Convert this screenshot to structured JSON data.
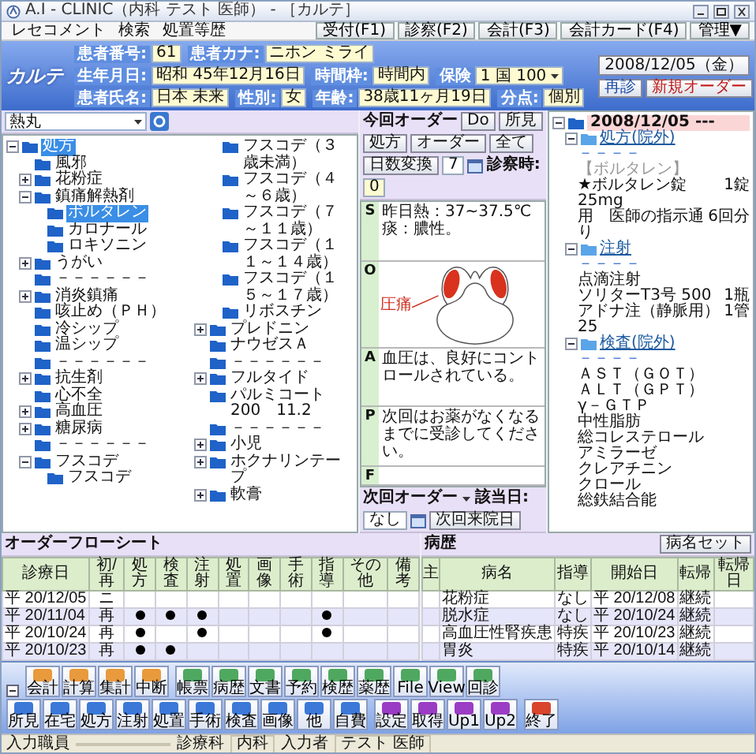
{
  "window": {
    "title": "A.I - CLINIC（内科 テスト 医師） - ［カルテ］"
  },
  "menu": [
    "レセコメント",
    "検索",
    "処置等歴"
  ],
  "top_buttons": [
    "受付(F1)",
    "診察(F2)",
    "会計(F3)",
    "会計カード(F4)",
    "管理▼"
  ],
  "patient": {
    "logo": "カルテ",
    "insurance_label": "保険",
    "insurance": "1 国 100",
    "fields": [
      {
        "label": "患者番号:",
        "value": "61"
      },
      {
        "label": "患者カナ:",
        "value": "ニホン ミライ"
      },
      {
        "label": "生年月日:",
        "value": "昭和 45年12月16日"
      },
      {
        "label": "時間枠:",
        "value": "時間内"
      },
      {
        "label": "患者氏名:",
        "value": "日本 未来"
      },
      {
        "label": "性別:",
        "value": "女"
      },
      {
        "label": "年齢:",
        "value": "38歳11ヶ月19日"
      },
      {
        "label": "分点:",
        "value": "個別"
      }
    ],
    "date": "2008/12/05（金）",
    "visit_type": "再診",
    "new_order": "新規オーダー"
  },
  "set_panel": {
    "category": "熱丸",
    "tree": [
      {
        "label": "処方",
        "expanded": true,
        "selected": true,
        "children": [
          {
            "label": "風邪",
            "selected": false
          },
          {
            "label": "花粉症",
            "expanded": false,
            "selected": false
          },
          {
            "label": "鎮痛解熱剤",
            "expanded": true,
            "selected": false,
            "children": [
              {
                "label": "ボルタレン",
                "selected": true
              },
              {
                "label": "カロナール",
                "selected": false
              },
              {
                "label": "ロキソニン",
                "selected": false
              }
            ]
          },
          {
            "label": "うがい",
            "expanded": false,
            "selected": false
          },
          {
            "label": "－－－－－－",
            "selected": false
          },
          {
            "label": "消炎鎮痛",
            "expanded": false,
            "selected": false
          },
          {
            "label": "咳止め（ＰＨ）",
            "selected": false
          },
          {
            "label": "冷シップ",
            "selected": false
          },
          {
            "label": "温シップ",
            "selected": false
          },
          {
            "label": "－－－－－－",
            "selected": false
          },
          {
            "label": "抗生剤",
            "expanded": false,
            "selected": false
          },
          {
            "label": "心不全",
            "selected": false
          },
          {
            "label": "高血圧",
            "expanded": false,
            "selected": false
          },
          {
            "label": "糖尿病",
            "expanded": false,
            "selected": false
          },
          {
            "label": "－－－－－－",
            "selected": false
          },
          {
            "label": "フスコデ",
            "expanded": true,
            "selected": false,
            "children": [
              {
                "label": "フスコデ",
                "selected": false
              },
              {
                "label": "フスコデ（３歳未満）",
                "selected": false
              },
              {
                "label": "フスコデ（４～６歳）",
                "selected": false
              },
              {
                "label": "フスコデ（７～１１歳）",
                "selected": false
              },
              {
                "label": "フスコデ（１１～１４歳）",
                "selected": false
              },
              {
                "label": "フスコデ（１５～１７歳）",
                "selected": false
              },
              {
                "label": "リボスチン",
                "selected": false
              }
            ]
          },
          {
            "label": "プレドニン",
            "expanded": false,
            "selected": false
          },
          {
            "label": "ナウゼスＡ",
            "selected": false
          },
          {
            "label": "－－－－－－",
            "selected": false
          },
          {
            "label": "フルタイド",
            "expanded": false,
            "selected": false
          },
          {
            "label": "パルミコート200　11.2",
            "selected": false
          },
          {
            "label": "－－－－－－",
            "selected": false
          },
          {
            "label": "小児",
            "expanded": false,
            "selected": false
          },
          {
            "label": "ホクナリンテープ",
            "expanded": false,
            "selected": false
          },
          {
            "label": "軟膏",
            "expanded": false,
            "selected": false
          }
        ]
      }
    ]
  },
  "order_bar": {
    "title": "今回オーダー",
    "buttons": [
      "Do",
      "所見",
      "処方",
      "オーダー",
      "全て"
    ],
    "convert": "日数変換",
    "days": "7",
    "exam_time_label": "診察時:",
    "exam_time": "0"
  },
  "soap": [
    {
      "letter": "S",
      "kind": "text",
      "lines": [
        "昨日熱：37~37.5℃",
        "痰：膿性。"
      ]
    },
    {
      "letter": "O",
      "kind": "drawing",
      "label": "圧痛"
    },
    {
      "letter": "A",
      "kind": "text",
      "lines": [
        "血圧は、良好にコントロールされている。"
      ]
    },
    {
      "letter": "P",
      "kind": "text",
      "lines": [
        "次回はお薬がなくなるまでに受診してください。"
      ]
    },
    {
      "letter": "F",
      "kind": "text"
    }
  ],
  "order_tree": [
    {
      "kind": "date",
      "label": "2008/12/05 ---",
      "expanded": true,
      "children": [
        {
          "kind": "group",
          "label": "処方(院外)",
          "expanded": true,
          "children": [
            {
              "kind": "dash",
              "label": "－－－－"
            },
            {
              "kind": "note",
              "label": "【ボルタレン】"
            },
            {
              "kind": "item",
              "label": "★ボルタレン錠 25mg",
              "qty": "1錠"
            },
            {
              "kind": "item",
              "label": "用　医師の指示通り",
              "qty": "6回分"
            }
          ]
        },
        {
          "kind": "group",
          "label": "注射",
          "expanded": true,
          "children": [
            {
              "kind": "dash",
              "label": "－－－－"
            },
            {
              "kind": "item",
              "label": "点滴注射"
            },
            {
              "kind": "item",
              "label": "ソリターT3号 500",
              "qty": "1瓶"
            },
            {
              "kind": "item",
              "label": "アドナ注（静脈用）25",
              "qty": "1管"
            }
          ]
        },
        {
          "kind": "group",
          "label": "検査(院外)",
          "expanded": true,
          "children": [
            {
              "kind": "dash",
              "label": "－－－－"
            },
            {
              "kind": "item",
              "label": "ＡＳＴ（ＧＯＴ）"
            },
            {
              "kind": "item",
              "label": "ＡＬＴ（ＧＰＴ）"
            },
            {
              "kind": "item",
              "label": "γ－ＧＴＰ"
            },
            {
              "kind": "item",
              "label": "中性脂肪"
            },
            {
              "kind": "item",
              "label": "総コレステロール"
            },
            {
              "kind": "item",
              "label": "アミラーゼ"
            },
            {
              "kind": "item",
              "label": "クレアチニン"
            },
            {
              "kind": "item",
              "label": "クロール"
            },
            {
              "kind": "item",
              "label": "総鉄結合能"
            }
          ]
        }
      ]
    }
  ],
  "next_order": {
    "label": "次回オーダー",
    "date_label": "該当日:",
    "date": "なし",
    "button": "次回来院日"
  },
  "flow_sheet": {
    "title": "オーダーフローシート",
    "columns": [
      "診療日",
      "初/再",
      "処方",
      "検査",
      "注射",
      "処置",
      "画像",
      "手術",
      "指導",
      "その他",
      "備考"
    ],
    "rows": [
      {
        "date": "平 20/12/05",
        "visit": "ニ",
        "marks": [
          false,
          false,
          false,
          false,
          false,
          false,
          false,
          false,
          false
        ]
      },
      {
        "date": "平 20/11/04",
        "visit": "再",
        "marks": [
          true,
          true,
          true,
          false,
          false,
          false,
          true,
          false,
          false
        ]
      },
      {
        "date": "平 20/10/24",
        "visit": "再",
        "marks": [
          true,
          false,
          true,
          false,
          false,
          false,
          true,
          false,
          false
        ]
      },
      {
        "date": "平 20/10/23",
        "visit": "再",
        "marks": [
          true,
          true,
          false,
          false,
          false,
          false,
          false,
          false,
          false
        ]
      }
    ]
  },
  "history": {
    "title": "病歴",
    "button": "病名セット",
    "columns": [
      "主",
      "病名",
      "指導",
      "開始日",
      "転帰",
      "転帰日"
    ],
    "rows": [
      {
        "name": "花粉症",
        "guidance": "なし",
        "start": "平 20/12/08",
        "outcome": "継続"
      },
      {
        "name": "脱水症",
        "guidance": "なし",
        "start": "平 20/10/24",
        "outcome": "継続"
      },
      {
        "name": "高血圧性腎疾患",
        "guidance": "特疾",
        "start": "平 20/10/23",
        "outcome": "継続"
      },
      {
        "name": "胃炎",
        "guidance": "特疾",
        "start": "平 20/10/14",
        "outcome": "継続"
      }
    ]
  },
  "toolbar": [
    {
      "color": "#e89a3c",
      "buttons": [
        "会計",
        "計算",
        "集計",
        "中断"
      ]
    },
    {
      "color": "#4fa860",
      "buttons": [
        "帳票",
        "病歴",
        "文書",
        "予約",
        "検歴",
        "薬歴",
        "File",
        "View",
        "回診"
      ]
    },
    {
      "color": "#3b78d8",
      "buttons": [
        "所見",
        "在宅",
        "処方",
        "注射",
        "処置",
        "手術",
        "検査",
        "画像",
        "他",
        "自費"
      ]
    },
    {
      "color": "#9b3cc4",
      "buttons": [
        "設定",
        "取得",
        "Up1",
        "Up2"
      ]
    },
    {
      "color": "#d8442c",
      "buttons": [
        "終了"
      ]
    }
  ],
  "status_bar": [
    {
      "label": "入力職員"
    },
    {
      "label": "診療科",
      "value": "内科"
    },
    {
      "label": "入力者",
      "value": "テスト 医師"
    }
  ]
}
